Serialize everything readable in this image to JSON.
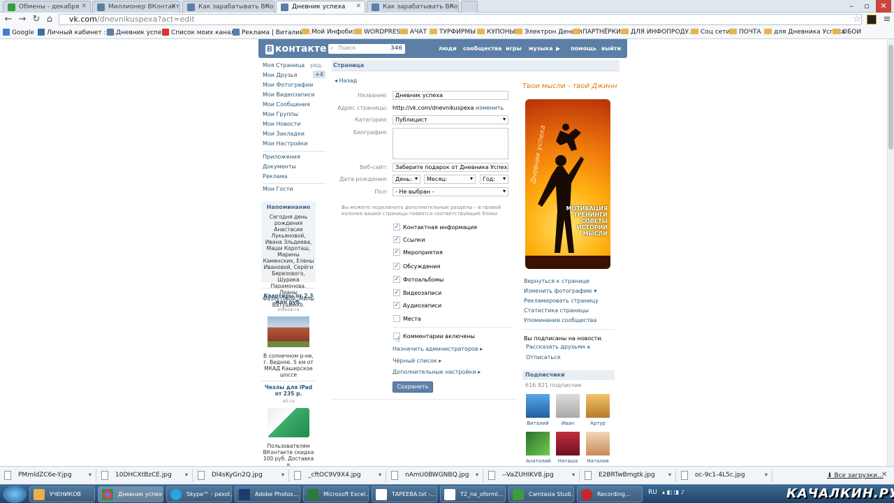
{
  "browser": {
    "tabs": [
      {
        "label": "Обмены - декабря",
        "color": "#3a9a43",
        "active": false
      },
      {
        "label": "Миллионер ВКонтакте",
        "color": "#5b7fa6",
        "active": false
      },
      {
        "label": "Как зарабатывать ВКонта",
        "color": "#5b7fa6",
        "active": false
      },
      {
        "label": "Дневник успеха",
        "color": "#5b7fa6",
        "active": true
      },
      {
        "label": "Как зарабатывать ВКонта",
        "color": "#5b7fa6",
        "active": false
      }
    ],
    "url_host": "vk.com",
    "url_path": "/dnevnikuspexa?act=edit",
    "bookmarks": [
      {
        "label": "Google",
        "type": "site"
      },
      {
        "label": "Личный кабинет :: ...",
        "type": "site"
      },
      {
        "label": "Дневник успеха",
        "type": "site"
      },
      {
        "label": "Список моих канал...",
        "type": "site"
      },
      {
        "label": "Реклама | Виталий ...",
        "type": "site"
      },
      {
        "label": "Мой Инфобиз",
        "type": "folder"
      },
      {
        "label": "WORDPRESS",
        "type": "folder"
      },
      {
        "label": "АЧАТ",
        "type": "folder"
      },
      {
        "label": "ТУРФИРМЫ",
        "type": "folder"
      },
      {
        "label": "КУПОНЫ",
        "type": "folder"
      },
      {
        "label": "Электрон Деньги",
        "type": "folder"
      },
      {
        "label": "ПАРТНЁРКИ",
        "type": "folder"
      },
      {
        "label": "ДЛЯ ИНФОПРОДУ...",
        "type": "folder"
      },
      {
        "label": "Соц сети",
        "type": "folder"
      },
      {
        "label": "ПОЧТА",
        "type": "folder"
      },
      {
        "label": "для Дневника Успеха",
        "type": "folder"
      },
      {
        "label": "ОБОИ",
        "type": "folder"
      }
    ]
  },
  "vk": {
    "logo": "контакте",
    "logo_letter": "В",
    "search_placeholder": "Поиск",
    "search_count": "346",
    "menu": [
      "люди",
      "сообщества",
      "игры",
      "музыка",
      "помощь",
      "выйти"
    ],
    "left_menu": [
      "Моя Страница",
      "Мои Друзья",
      "Мои Фотографии",
      "Мои Видеозаписи",
      "Мои Сообщения",
      "Мои Группы",
      "Мои Новости",
      "Мои Закладки",
      "Мои Настройки"
    ],
    "left_edit": "ред.",
    "friends_badge": "+4",
    "left_menu2": [
      "Приложения",
      "Документы",
      "Реклама"
    ],
    "left_guests": "Мои Гости",
    "reminder_title": "Напоминание",
    "reminder_text": "Сегодня день рождения Анастасии Лукьяновой, Ивана Зльдиева, Маши Короташ, Марины Каменских, Елены Ивановой, Серёги Березового, Шурика Парамонова, Лианы Фазлутовой, Милы Ватушенко.",
    "ad1_title": "Квартиры от 2.3 млн руб.",
    "ad1_domain": "vidnoe.ru",
    "ad1_text": "В солнечном р-не, г. Видное. 5 км от МКАД Каширское шоссе",
    "ad2_title": "Чехлы для iPad от 235 р.",
    "ad2_domain": "a5.ru",
    "ad2_text": "Пользователям ВКонтакте скидка 100 руб. Доставка в"
  },
  "form": {
    "breadcrumb": "Страница",
    "back": "Назад",
    "name_label": "Название:",
    "name_value": "Дневник успеха",
    "address_label": "Адрес страницы:",
    "address_value": "http://vk.com/dnevnikuspexa",
    "address_change": "изменить",
    "category_label": "Категория:",
    "category_value": "Публицист",
    "bio_label": "Биография:",
    "website_label": "Веб-сайт:",
    "website_value": "Заберите подарок от Дневника Успеха http://s",
    "birth_label": "Дата рождения:",
    "birth_day": "День:",
    "birth_month": "Месяц:",
    "birth_year": "Год:",
    "sex_label": "Пол:",
    "sex_value": "- Не выбран -",
    "sections_hint": "Вы можете подключить дополнительные разделы – в правой колонке вашей страницы появятся соответствующие блоки",
    "sections": [
      {
        "label": "Контактная информация",
        "checked": true
      },
      {
        "label": "Ссылки",
        "checked": true
      },
      {
        "label": "Мероприятия",
        "checked": true
      },
      {
        "label": "Обсуждения",
        "checked": true
      },
      {
        "label": "Фотоальбомы",
        "checked": true
      },
      {
        "label": "Видеозаписи",
        "checked": true
      },
      {
        "label": "Аудиозаписи",
        "checked": true
      },
      {
        "label": "Места",
        "checked": false
      }
    ],
    "comments_label": "Комментарии включены",
    "links": [
      "Назначить администраторов",
      "Чёрный список",
      "Дополнительные настройки"
    ],
    "save": "Сохранить"
  },
  "right": {
    "slogan": "Твои мысли - твой Джинн",
    "poster_lines": [
      "МОТИВАЦИЯ",
      "ТРЕНИНГИ",
      "СОВЕТЫ",
      "ИСТОРИИ",
      "МЫСЛИ"
    ],
    "poster_script": "Дневник успеха",
    "links": [
      "Вернуться к странице",
      "Изменить фотографию",
      "Рекламировать страницу",
      "Статистика страницы",
      "Упоминания сообщества"
    ],
    "subscribed_text": "Вы подписаны на новости.",
    "tell_friends": "Рассказать друзьям",
    "unsubscribe": "Отписаться",
    "subscribers_title": "Подписчики",
    "subscribers_count": "616 821 подписчик",
    "subscribers": [
      "Виталий",
      "Иван",
      "Артур",
      "Анатолий",
      "Наташа",
      "Наталия"
    ]
  },
  "downloads": {
    "items": [
      "PMmldZC6e-Y.jpg",
      "10DHCXtBzCE.jpg",
      "Dl4sKyGn2Q.jpg",
      "_cftOC9V9X4.jpg",
      "nAmU0BWGNBQ.jpg",
      "--VaZUHIKV8.jpg",
      "E2BRTwBmgtk.jpg",
      "oc-9c1-4L5c.jpg"
    ],
    "all": "Все загрузки..."
  },
  "taskbar": {
    "items": [
      {
        "label": "УЧЕНИКОВ",
        "color": "#e8b14a"
      },
      {
        "label": "Дневник успех...",
        "color": "#e2e2e2"
      },
      {
        "label": "Skype™ - pexot...",
        "color": "#23a6e0"
      },
      {
        "label": "Adobe Photos...",
        "color": "#1b3d6e"
      },
      {
        "label": "Microsoft Excel...",
        "color": "#2a7b3a"
      },
      {
        "label": "ТАРЕЕВА.txt -...",
        "color": "#ffffff"
      },
      {
        "label": "T2_na_oforml...",
        "color": "#ffffff"
      },
      {
        "label": "Camtasia Studi...",
        "color": "#3f9a3f"
      },
      {
        "label": "Recording...",
        "color": "#c62828"
      }
    ],
    "lang": "RU",
    "watermark": "КАЧАЛКИН.РУ"
  }
}
